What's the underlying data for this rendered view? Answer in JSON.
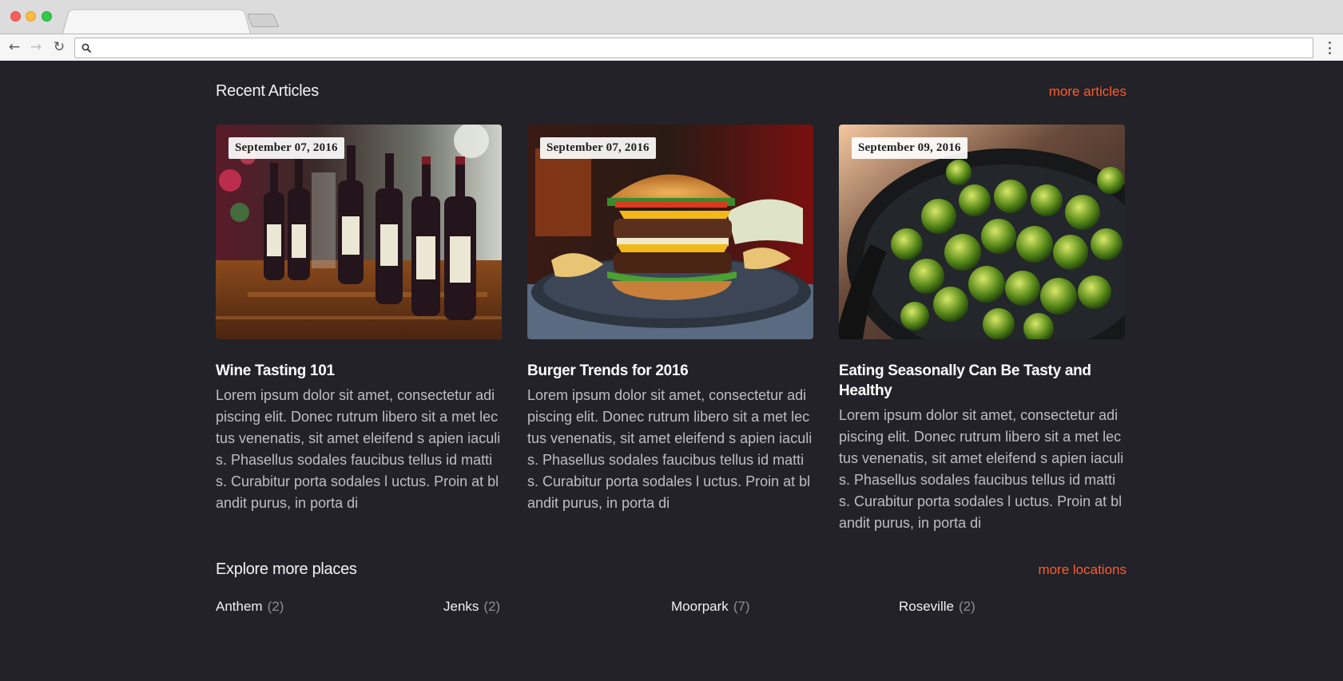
{
  "browser": {
    "url": "",
    "back_icon": "arrow-left-icon",
    "forward_icon": "arrow-right-icon",
    "reload_icon": "reload-icon",
    "search_icon": "search-icon",
    "menu_icon": "vertical-dots-icon"
  },
  "recent": {
    "title": "Recent Articles",
    "more_link": "more articles",
    "articles": [
      {
        "date": "September 07, 2016",
        "title": "Wine Tasting 101",
        "body": "Lorem ipsum dolor sit amet, consectetur adipiscing elit. Donec rutrum libero sit a met lectus venenatis, sit amet eleifend s apien iaculis. Phasellus sodales faucibus tellus id mattis. Curabitur porta sodales l uctus. Proin at blandit purus, in porta di",
        "image": "wine-bottles-photo"
      },
      {
        "date": "September 07, 2016",
        "title": "Burger Trends for 2016",
        "body": "Lorem ipsum dolor sit amet, consectetur adipiscing elit. Donec rutrum libero sit a met lectus venenatis, sit amet eleifend s apien iaculis. Phasellus sodales faucibus tellus id mattis. Curabitur porta sodales l uctus. Proin at blandit purus, in porta di",
        "image": "burger-photo"
      },
      {
        "date": "September 09, 2016",
        "title": "Eating Seasonally Can Be Tasty and Healthy",
        "body": "Lorem ipsum dolor sit amet, consectetur adipiscing elit. Donec rutrum libero sit a met lectus venenatis, sit amet eleifend s apien iaculis. Phasellus sodales faucibus tellus id mattis. Curabitur porta sodales l uctus. Proin at blandit purus, in porta di",
        "image": "brussels-sprouts-photo"
      }
    ]
  },
  "explore": {
    "title": "Explore more places",
    "more_link": "more locations",
    "places": [
      {
        "name": "Anthem",
        "count": "(2)"
      },
      {
        "name": "Jenks",
        "count": "(2)"
      },
      {
        "name": "Moorpark",
        "count": "(7)"
      },
      {
        "name": "Roseville",
        "count": "(2)"
      }
    ]
  },
  "colors": {
    "page_background": "#222228",
    "accent": "#ff5a2b",
    "body_text": "#bdbdc2",
    "heading_text": "#ffffff"
  }
}
